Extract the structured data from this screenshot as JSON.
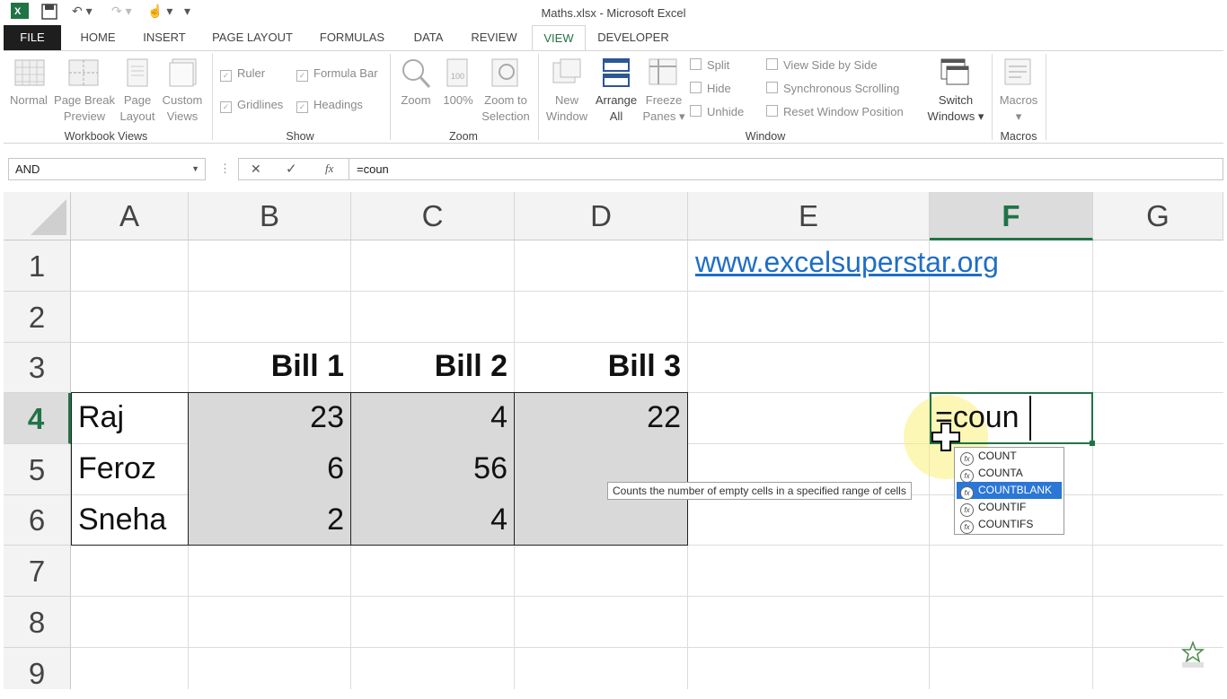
{
  "window": {
    "title": "Maths.xlsx - Microsoft Excel"
  },
  "tabs": [
    "FILE",
    "HOME",
    "INSERT",
    "PAGE LAYOUT",
    "FORMULAS",
    "DATA",
    "REVIEW",
    "VIEW",
    "DEVELOPER"
  ],
  "ribbon": {
    "workbook_views": {
      "group": "Workbook Views",
      "normal": "Normal",
      "page_break_1": "Page Break",
      "page_break_2": "Preview",
      "page_layout_1": "Page",
      "page_layout_2": "Layout",
      "custom_1": "Custom",
      "custom_2": "Views"
    },
    "show": {
      "group": "Show",
      "ruler": "Ruler",
      "formula_bar": "Formula Bar",
      "gridlines": "Gridlines",
      "headings": "Headings"
    },
    "zoom": {
      "group": "Zoom",
      "zoom": "Zoom",
      "hundred": "100%",
      "zoom_sel_1": "Zoom to",
      "zoom_sel_2": "Selection"
    },
    "window": {
      "group": "Window",
      "new_1": "New",
      "new_2": "Window",
      "arrange_1": "Arrange",
      "arrange_2": "All",
      "freeze_1": "Freeze",
      "freeze_2": "Panes",
      "split": "Split",
      "hide": "Hide",
      "unhide": "Unhide",
      "side": "View Side by Side",
      "sync": "Synchronous Scrolling",
      "reset": "Reset Window Position",
      "switch_1": "Switch",
      "switch_2": "Windows"
    },
    "macros": {
      "group": "Macros",
      "macros": "Macros"
    }
  },
  "formula_bar": {
    "name_box": "AND",
    "cancel": "✕",
    "enter": "✓",
    "fx": "fx",
    "formula": "=coun"
  },
  "sheet": {
    "columns": [
      "A",
      "B",
      "C",
      "D",
      "E",
      "F",
      "G"
    ],
    "rows": [
      "1",
      "2",
      "3",
      "4",
      "5",
      "6",
      "7",
      "8",
      "9"
    ],
    "link": "www.excelsuperstar.org",
    "headers": [
      "Bill 1",
      "Bill 2",
      "Bill 3"
    ],
    "data": [
      {
        "name": "Raj",
        "b": "23",
        "c": "4",
        "d": "22"
      },
      {
        "name": "Feroz",
        "b": "6",
        "c": "56",
        "d": ""
      },
      {
        "name": "Sneha",
        "b": "2",
        "c": "4",
        "d": ""
      }
    ],
    "editing": "=coun"
  },
  "autocomplete": {
    "items": [
      "COUNT",
      "COUNTA",
      "COUNTBLANK",
      "COUNTIF",
      "COUNTIFS"
    ],
    "selected": 2,
    "tooltip": "Counts the number of empty cells in a specified range of cells"
  },
  "colors": {
    "accent": "#217346",
    "selection": "#2b76d6",
    "link": "#1f6fc5",
    "range_fill": "#d9d9d9"
  }
}
